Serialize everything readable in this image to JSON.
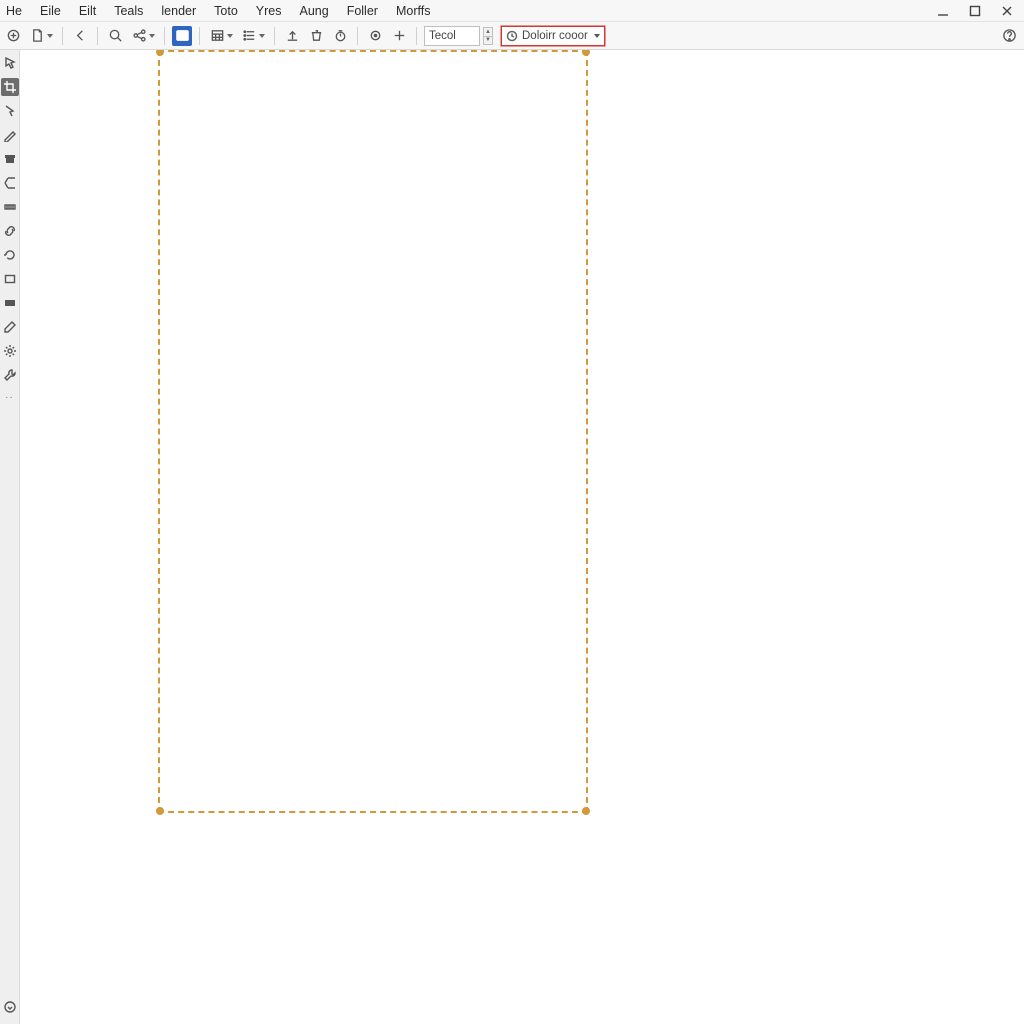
{
  "menubar": {
    "items": [
      {
        "label": "He"
      },
      {
        "label": "Eile"
      },
      {
        "label": "Eilt"
      },
      {
        "label": "Teals"
      },
      {
        "label": "lender"
      },
      {
        "label": "Toto"
      },
      {
        "label": "Yres"
      },
      {
        "label": "Aung"
      },
      {
        "label": "Foller"
      },
      {
        "label": "Morffs"
      }
    ]
  },
  "window_controls": {
    "minimize": "minimize",
    "maximize": "maximize",
    "close": "close"
  },
  "toolbar": {
    "text_input_value": "Tecol",
    "combo_label": "Doloirr cooor",
    "icons": {
      "new": "new-doc",
      "page": "page",
      "back": "back",
      "zoom": "zoom",
      "share": "share",
      "image": "image",
      "table": "table",
      "list": "list",
      "up": "upload",
      "trash": "trash",
      "timer": "timer",
      "target": "target",
      "plus": "plus",
      "help": "help"
    }
  },
  "left_toolbox": {
    "tools": [
      "select",
      "crop",
      "pointer",
      "pen",
      "brush",
      "book",
      "measure",
      "ruler",
      "link",
      "rotate",
      "rect",
      "panel",
      "eyedrop",
      "gear",
      "wrench"
    ],
    "bottom": "expand"
  },
  "canvas": {
    "selection_color": "#d09a3a"
  }
}
